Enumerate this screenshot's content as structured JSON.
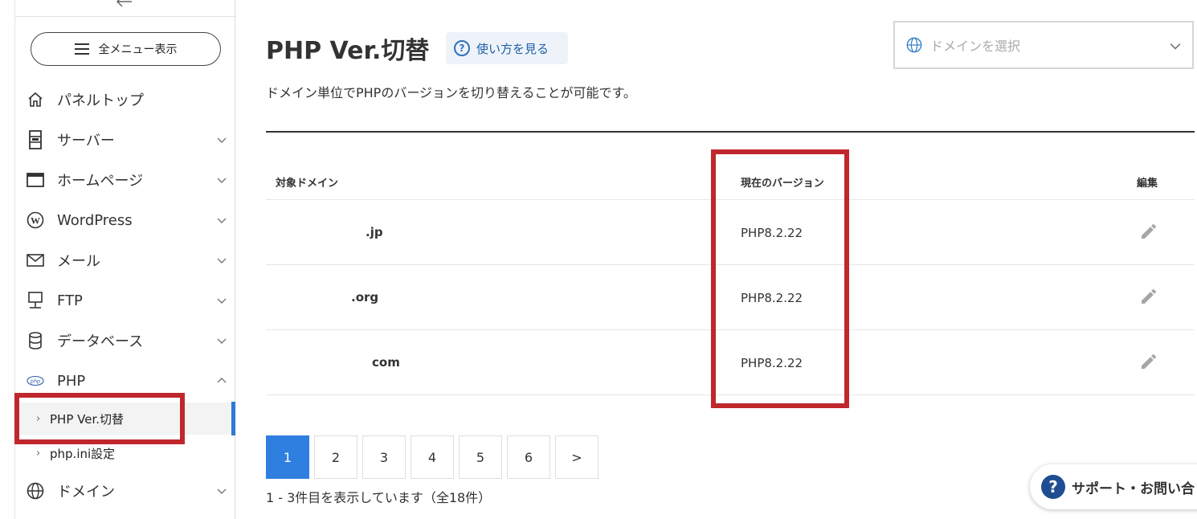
{
  "sidebar": {
    "menu_button_label": "全メニュー表示",
    "items": [
      {
        "label": "パネルトップ",
        "icon": "home-icon"
      },
      {
        "label": "サーバー",
        "icon": "server-icon"
      },
      {
        "label": "ホームページ",
        "icon": "browser-icon"
      },
      {
        "label": "WordPress",
        "icon": "wordpress-icon"
      },
      {
        "label": "メール",
        "icon": "mail-icon"
      },
      {
        "label": "FTP",
        "icon": "ftp-icon"
      },
      {
        "label": "データベース",
        "icon": "database-icon"
      },
      {
        "label": "PHP",
        "icon": "php-icon"
      },
      {
        "label": "ドメイン",
        "icon": "globe-icon"
      }
    ],
    "sub_items": [
      {
        "label": "PHP Ver.切替",
        "active": true
      },
      {
        "label": "php.ini設定",
        "active": false
      }
    ],
    "php_icon_text": "php"
  },
  "main": {
    "title": "PHP Ver.切替",
    "help_label": "使い方を見る",
    "domain_select_placeholder": "ドメインを選択",
    "description": "ドメイン単位でPHPのバージョンを切り替えることが可能です。",
    "table": {
      "headers": {
        "domain": "対象ドメイン",
        "version": "現在のバージョン",
        "edit": "編集"
      },
      "rows": [
        {
          "domain": ".jp",
          "version": "PHP8.2.22"
        },
        {
          "domain": ".org",
          "version": "PHP8.2.22"
        },
        {
          "domain": "com",
          "version": "PHP8.2.22"
        }
      ]
    },
    "pagination": [
      "1",
      "2",
      "3",
      "4",
      "5",
      "6",
      ">"
    ],
    "current_page": "1",
    "count_text": "1 - 3件目を表示しています（全18件）",
    "support_label": "サポート・お問い合"
  },
  "colors": {
    "accent": "#2f7fe0",
    "highlight": "#c0272d",
    "support_icon": "#1e4d91"
  }
}
